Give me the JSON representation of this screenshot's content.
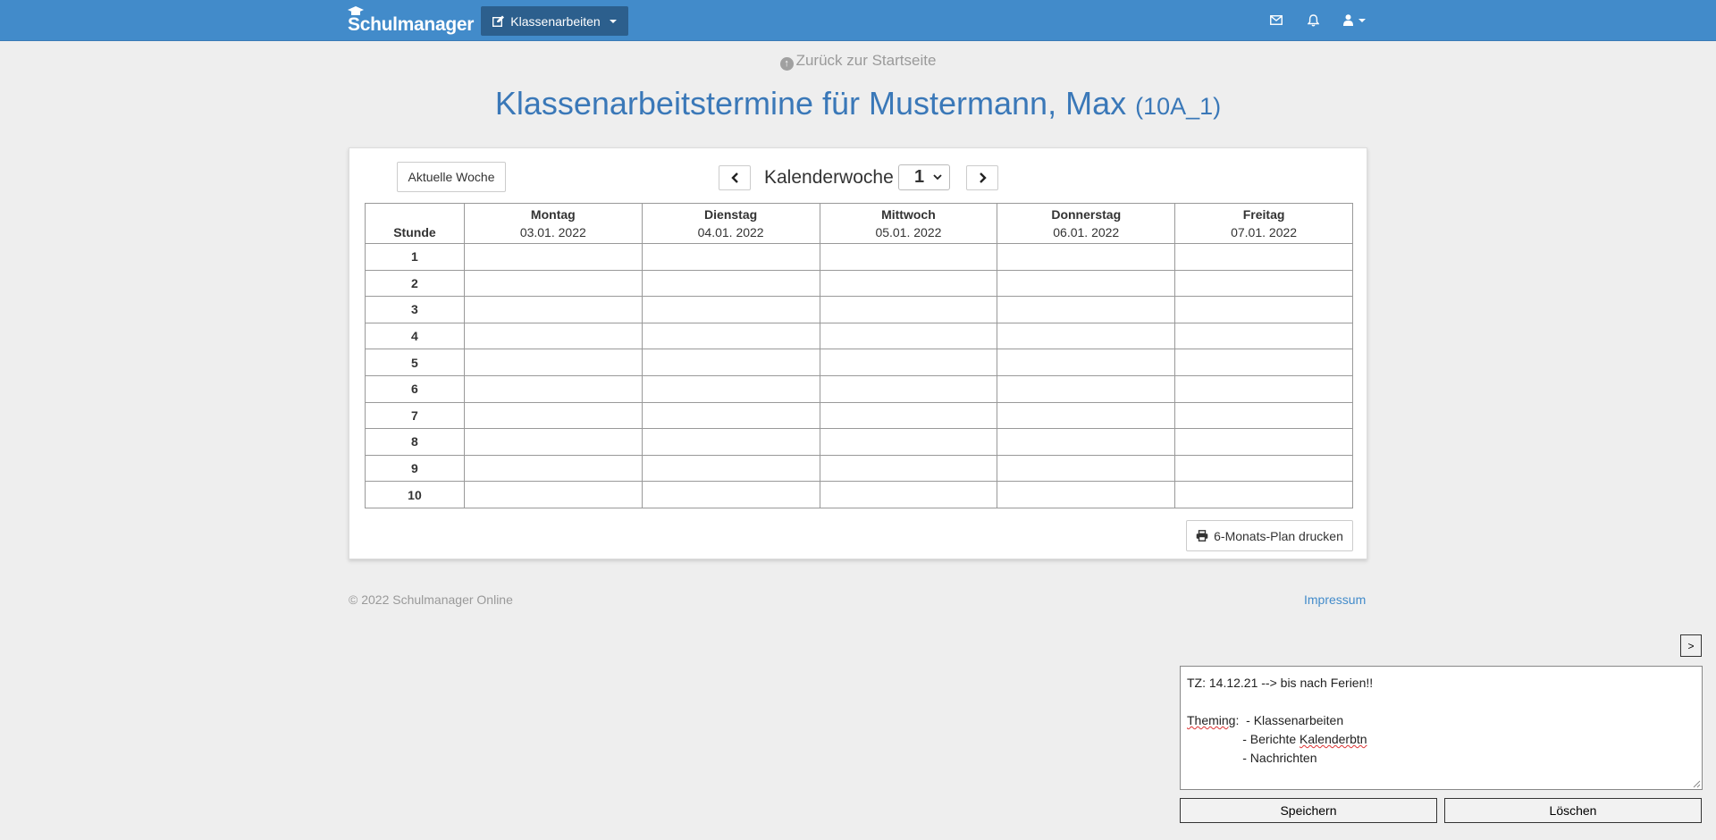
{
  "navbar": {
    "brand": "Schulmanager",
    "menu_label": "Klassenarbeiten",
    "icons": [
      "envelope-icon",
      "bell-icon",
      "user-icon"
    ]
  },
  "back_link": "Zurück zur Startseite",
  "page_title": "Klassenarbeitstermine für Mustermann, Max",
  "page_title_class": "(10A_1)",
  "controls": {
    "current_week": "Aktuelle Woche",
    "week_label": "Kalenderwoche",
    "week_value": "1"
  },
  "table": {
    "hour_header": "Stunde",
    "days": [
      {
        "name": "Montag",
        "date": "03.01. 2022"
      },
      {
        "name": "Dienstag",
        "date": "04.01. 2022"
      },
      {
        "name": "Mittwoch",
        "date": "05.01. 2022"
      },
      {
        "name": "Donnerstag",
        "date": "06.01. 2022"
      },
      {
        "name": "Freitag",
        "date": "07.01. 2022"
      }
    ],
    "hours": [
      "1",
      "2",
      "3",
      "4",
      "5",
      "6",
      "7",
      "8",
      "9",
      "10"
    ]
  },
  "print_button": "6-Monats-Plan drucken",
  "footer": {
    "copyright": "© 2022 Schulmanager Online",
    "impressum": "Impressum"
  },
  "notes_panel": {
    "toggle": ">",
    "line1": "TZ: 14.12.21 --> bis nach Ferien!!",
    "theming_word": "Theming",
    "items": [
      "Klassenarbeiten",
      "Berichte",
      "Nachrichten"
    ],
    "kalender_word": "Kalenderbtn",
    "save": "Speichern",
    "delete": "Löschen"
  },
  "colors": {
    "navbar": "#428bca",
    "dropdown_active": "#2c5f8d",
    "title": "#3a78b8",
    "background": "#eeeeee"
  }
}
